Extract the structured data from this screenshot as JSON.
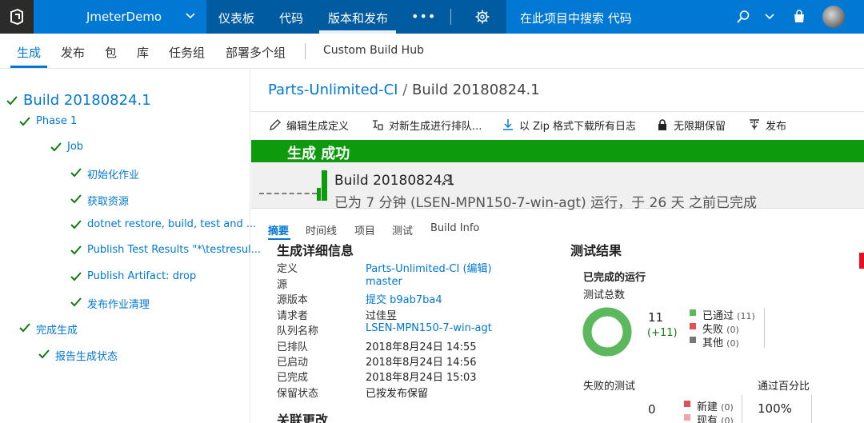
{
  "topbar": {
    "project": "JmeterDemo",
    "nav": [
      {
        "label": "仪表板"
      },
      {
        "label": "代码"
      },
      {
        "label": "版本和发布"
      }
    ],
    "more": "•••",
    "search_placeholder": "在此项目中搜索 代码"
  },
  "subnav": {
    "items": [
      "生成",
      "发布",
      "包",
      "库",
      "任务组",
      "部署多个组"
    ],
    "custom": "Custom Build Hub"
  },
  "tree": {
    "build": "Build 20180824.1",
    "phase": "Phase 1",
    "job": "Job",
    "steps": [
      "初始化作业",
      "获取资源",
      "dotnet restore, build, test and ...",
      "Publish Test Results \"*\\testresul...",
      "Publish Artifact: drop",
      "发布作业清理"
    ],
    "finish": "完成生成",
    "report": "报告生成状态"
  },
  "breadcrumb": {
    "pipeline": "Parts-Unlimited-CI",
    "separator": "/",
    "build": "Build 20180824.1"
  },
  "toolbar": {
    "edit": "编辑生成定义",
    "queue": "对新生成进行排队...",
    "download": "以 Zip 格式下载所有日志",
    "retain": "无限期保留",
    "release": "发布"
  },
  "status": {
    "banner": "生成 成功",
    "build_title": "Build 20180824.1",
    "description": "已为 7 分钟 (LSEN-MPN150-7-win-agt) 运行，于 26 天 之前已完成"
  },
  "tabs": [
    "摘要",
    "时间线",
    "项目",
    "测试",
    "Build Info"
  ],
  "details": {
    "title": "生成详细信息",
    "rows": [
      {
        "key": "定义",
        "value": "Parts-Unlimited-CI (编辑)"
      },
      {
        "key": "源",
        "value": "master"
      },
      {
        "key": "源版本",
        "value": "提交 b9ab7ba4"
      },
      {
        "key": "请求者",
        "value": "过佳昱"
      },
      {
        "key": "队列名称",
        "value": "LSEN-MPN150-7-win-agt"
      },
      {
        "key": "已排队",
        "value": "2018年8月24日 14:55"
      },
      {
        "key": "已启动",
        "value": "2018年8月24日 14:56"
      },
      {
        "key": "已完成",
        "value": "2018年8月24日 15:03"
      },
      {
        "key": "保留状态",
        "value": "已按发布保留"
      }
    ],
    "related_title": "关联更改"
  },
  "tests": {
    "title": "测试结果",
    "completed_runs": "已完成的运行",
    "total_label": "测试总数",
    "total": "11",
    "delta": "(+11)",
    "pass_fraction": 1.0,
    "legend": [
      {
        "label": "已通过",
        "count": "(11)",
        "color": "#5cb85c"
      },
      {
        "label": "失败",
        "count": "(0)",
        "color": "#e05252"
      },
      {
        "label": "其他",
        "count": "(0)",
        "color": "#777777"
      }
    ],
    "failed_label": "失败的测试",
    "failed_count": "0",
    "failed_legend": [
      {
        "label": "新建",
        "count": "(0)",
        "color": "#e05252"
      },
      {
        "label": "现有",
        "count": "(0)",
        "color": "#f2a5a5"
      }
    ],
    "pass_pct_label": "通过百分比",
    "pass_pct": "100%"
  },
  "colors": {
    "brand": "#0078d4",
    "success": "#0d9b0d",
    "tree_check": "#107c10"
  }
}
